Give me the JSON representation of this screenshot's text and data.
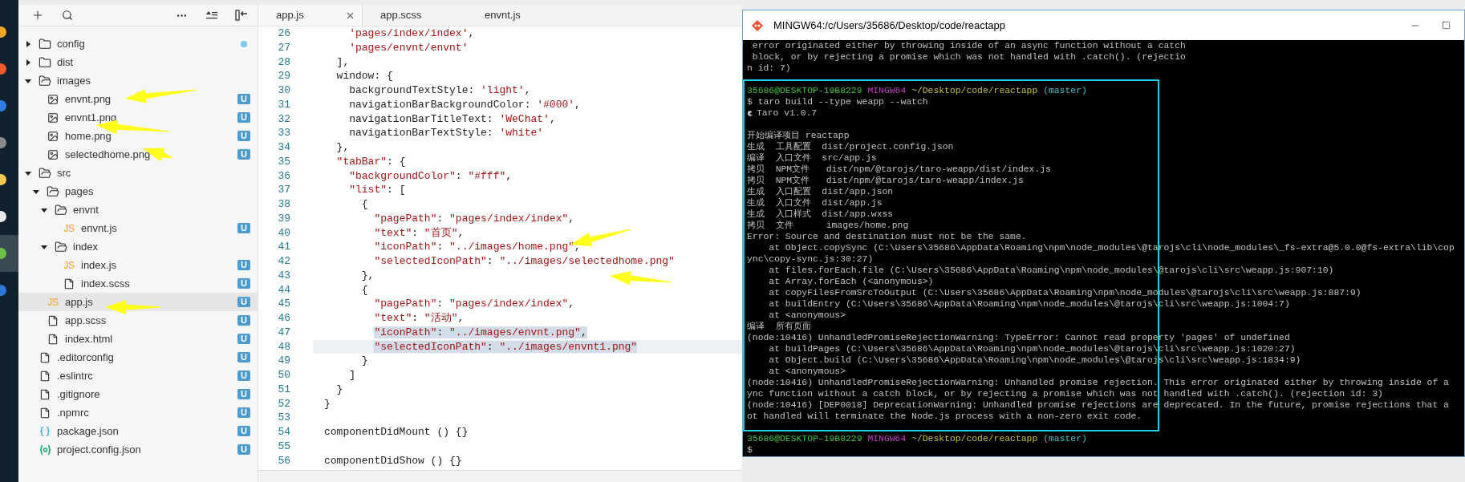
{
  "activity_bar": [
    {
      "selected": false
    },
    {
      "selected": false
    },
    {
      "selected": false
    },
    {
      "selected": false
    },
    {
      "selected": false
    },
    {
      "selected": false
    },
    {
      "selected": true
    },
    {
      "selected": false
    }
  ],
  "sidebar": {
    "tree": [
      {
        "name": "config",
        "kind": "folder",
        "expanded": false,
        "selected": false,
        "modified": true
      },
      {
        "name": "dist",
        "kind": "folder",
        "expanded": false,
        "selected": false
      },
      {
        "name": "images",
        "kind": "folder",
        "expanded": true,
        "selected": false,
        "children": [
          {
            "name": "envnt.png",
            "kind": "image",
            "selected": false,
            "badge": "U"
          },
          {
            "name": "envnt1.png",
            "kind": "image",
            "selected": false,
            "badge": "U"
          },
          {
            "name": "home.png",
            "kind": "image",
            "selected": false,
            "badge": "U"
          },
          {
            "name": "selectedhome.png",
            "kind": "image",
            "selected": false,
            "badge": "U"
          }
        ]
      },
      {
        "name": "src",
        "kind": "folder",
        "expanded": true,
        "selected": false,
        "children": [
          {
            "name": "pages",
            "kind": "folder",
            "expanded": true,
            "selected": false,
            "children": [
              {
                "name": "envnt",
                "kind": "folder",
                "expanded": true,
                "selected": false,
                "children": [
                  {
                    "name": "envnt.js",
                    "kind": "js",
                    "type_label": "JS",
                    "selected": false,
                    "badge": "U"
                  }
                ]
              },
              {
                "name": "index",
                "kind": "folder",
                "expanded": true,
                "selected": false,
                "children": [
                  {
                    "name": "index.js",
                    "kind": "js",
                    "type_label": "JS",
                    "selected": false,
                    "badge": "U"
                  },
                  {
                    "name": "index.scss",
                    "kind": "file",
                    "selected": false,
                    "badge": "U"
                  }
                ]
              }
            ]
          },
          {
            "name": "app.js",
            "kind": "js",
            "type_label": "JS",
            "selected": true,
            "badge": "U"
          },
          {
            "name": "app.scss",
            "kind": "file",
            "selected": false,
            "badge": "U"
          },
          {
            "name": "index.html",
            "kind": "file",
            "selected": false,
            "badge": "U"
          }
        ]
      },
      {
        "name": ".editorconfig",
        "kind": "file",
        "selected": false,
        "badge": "U"
      },
      {
        "name": ".eslintrc",
        "kind": "file",
        "selected": false,
        "badge": "U"
      },
      {
        "name": ".gitignore",
        "kind": "file",
        "selected": false,
        "badge": "U"
      },
      {
        "name": ".npmrc",
        "kind": "file",
        "selected": false,
        "badge": "U"
      },
      {
        "name": "package.json",
        "kind": "json",
        "selected": false,
        "badge": "U"
      },
      {
        "name": "project.config.json",
        "kind": "config",
        "selected": false,
        "badge": "U"
      }
    ]
  },
  "editor": {
    "tabs": [
      {
        "label": "app.js",
        "selected": true
      },
      {
        "label": "app.scss",
        "selected": false
      },
      {
        "label": "envnt.js",
        "selected": false
      }
    ],
    "lines": [
      {
        "number": "26",
        "selected": false,
        "current": false,
        "segments": [
          {
            "text": "    'pages/index/index'",
            "kind": "string"
          },
          {
            "text": ",",
            "kind": "plain"
          }
        ]
      },
      {
        "number": "27",
        "selected": false,
        "current": false,
        "segments": [
          {
            "text": "    'pages/envnt/envnt'",
            "kind": "string"
          }
        ]
      },
      {
        "number": "28",
        "selected": false,
        "current": false,
        "segments": [
          {
            "text": "  ],",
            "kind": "plain"
          }
        ]
      },
      {
        "number": "29",
        "selected": false,
        "current": false,
        "segments": [
          {
            "text": "  window: {",
            "kind": "plain"
          }
        ]
      },
      {
        "number": "30",
        "selected": false,
        "current": false,
        "segments": [
          {
            "text": "    backgroundTextStyle: ",
            "kind": "plain"
          },
          {
            "text": "'light'",
            "kind": "string"
          },
          {
            "text": ",",
            "kind": "plain"
          }
        ]
      },
      {
        "number": "31",
        "selected": false,
        "current": false,
        "segments": [
          {
            "text": "    navigationBarBackgroundColor: ",
            "kind": "plain"
          },
          {
            "text": "'#000'",
            "kind": "string"
          },
          {
            "text": ",",
            "kind": "plain"
          }
        ]
      },
      {
        "number": "32",
        "selected": false,
        "current": false,
        "segments": [
          {
            "text": "    navigationBarTitleText: ",
            "kind": "plain"
          },
          {
            "text": "'WeChat'",
            "kind": "string"
          },
          {
            "text": ",",
            "kind": "plain"
          }
        ]
      },
      {
        "number": "33",
        "selected": false,
        "current": false,
        "segments": [
          {
            "text": "    navigationBarTextStyle: ",
            "kind": "plain"
          },
          {
            "text": "'white'",
            "kind": "string"
          }
        ]
      },
      {
        "number": "34",
        "selected": false,
        "current": false,
        "segments": [
          {
            "text": "  },",
            "kind": "plain"
          }
        ]
      },
      {
        "number": "35",
        "selected": false,
        "current": false,
        "segments": [
          {
            "text": "  \"tabBar\"",
            "kind": "string"
          },
          {
            "text": ": {",
            "kind": "plain"
          }
        ]
      },
      {
        "number": "36",
        "selected": false,
        "current": false,
        "segments": [
          {
            "text": "    \"backgroundColor\"",
            "kind": "string"
          },
          {
            "text": ": ",
            "kind": "plain"
          },
          {
            "text": "\"#fff\"",
            "kind": "string"
          },
          {
            "text": ",",
            "kind": "plain"
          }
        ]
      },
      {
        "number": "37",
        "selected": false,
        "current": false,
        "segments": [
          {
            "text": "    \"list\"",
            "kind": "string"
          },
          {
            "text": ": [",
            "kind": "plain"
          }
        ]
      },
      {
        "number": "38",
        "selected": false,
        "current": false,
        "segments": [
          {
            "text": "      {",
            "kind": "plain"
          }
        ]
      },
      {
        "number": "39",
        "selected": false,
        "current": false,
        "segments": [
          {
            "text": "        \"pagePath\"",
            "kind": "string"
          },
          {
            "text": ": ",
            "kind": "plain"
          },
          {
            "text": "\"pages/index/index\"",
            "kind": "string"
          },
          {
            "text": ",",
            "kind": "plain"
          }
        ]
      },
      {
        "number": "40",
        "selected": false,
        "current": false,
        "segments": [
          {
            "text": "        \"text\"",
            "kind": "string"
          },
          {
            "text": ": ",
            "kind": "plain"
          },
          {
            "text": "\"首页\"",
            "kind": "string"
          },
          {
            "text": ",",
            "kind": "plain"
          }
        ]
      },
      {
        "number": "41",
        "selected": false,
        "current": false,
        "segments": [
          {
            "text": "        \"iconPath\"",
            "kind": "string"
          },
          {
            "text": ": ",
            "kind": "plain"
          },
          {
            "text": "\"../images/home.png\"",
            "kind": "string"
          },
          {
            "text": ",",
            "kind": "plain"
          }
        ]
      },
      {
        "number": "42",
        "selected": false,
        "current": false,
        "segments": [
          {
            "text": "        \"selectedIconPath\"",
            "kind": "string"
          },
          {
            "text": ": ",
            "kind": "plain"
          },
          {
            "text": "\"../images/selectedhome.png\"",
            "kind": "string"
          }
        ]
      },
      {
        "number": "43",
        "selected": false,
        "current": false,
        "segments": [
          {
            "text": "      },",
            "kind": "plain"
          }
        ]
      },
      {
        "number": "44",
        "selected": false,
        "current": false,
        "segments": [
          {
            "text": "      {",
            "kind": "plain"
          }
        ]
      },
      {
        "number": "45",
        "selected": false,
        "current": false,
        "segments": [
          {
            "text": "        \"pagePath\"",
            "kind": "string"
          },
          {
            "text": ": ",
            "kind": "plain"
          },
          {
            "text": "\"pages/index/index\"",
            "kind": "string"
          },
          {
            "text": ",",
            "kind": "plain"
          }
        ]
      },
      {
        "number": "46",
        "selected": false,
        "current": false,
        "segments": [
          {
            "text": "        \"text\"",
            "kind": "string"
          },
          {
            "text": ": ",
            "kind": "plain"
          },
          {
            "text": "\"活动\"",
            "kind": "string"
          },
          {
            "text": ",",
            "kind": "plain"
          }
        ]
      },
      {
        "number": "47",
        "selected": true,
        "current": false,
        "segments": [
          {
            "text": "        \"iconPath\"",
            "kind": "string"
          },
          {
            "text": ": ",
            "kind": "plain"
          },
          {
            "text": "\"../images/envnt.png\"",
            "kind": "string"
          },
          {
            "text": ",",
            "kind": "plain"
          }
        ]
      },
      {
        "number": "48",
        "selected": true,
        "current": true,
        "segments": [
          {
            "text": "        \"selectedIconPath\"",
            "kind": "string"
          },
          {
            "text": ": ",
            "kind": "plain"
          },
          {
            "text": "\"../images/envnt1.png\"",
            "kind": "string"
          }
        ]
      },
      {
        "number": "49",
        "selected": false,
        "current": false,
        "segments": [
          {
            "text": "      }",
            "kind": "plain"
          }
        ]
      },
      {
        "number": "50",
        "selected": false,
        "current": false,
        "segments": [
          {
            "text": "    ]",
            "kind": "plain"
          }
        ]
      },
      {
        "number": "51",
        "selected": false,
        "current": false,
        "segments": [
          {
            "text": "  }",
            "kind": "plain"
          }
        ]
      },
      {
        "number": "52",
        "selected": false,
        "current": false,
        "segments": [
          {
            "text": "}",
            "kind": "plain"
          }
        ]
      },
      {
        "number": "53"
      },
      {
        "number": "54",
        "selected": false,
        "current": false,
        "segments": [
          {
            "text": "componentDidMount () {}",
            "kind": "plain"
          }
        ]
      },
      {
        "number": "55"
      },
      {
        "number": "56",
        "selected": false,
        "current": false,
        "segments": [
          {
            "text": "componentDidShow () {}",
            "kind": "plain"
          }
        ]
      }
    ]
  },
  "terminal": {
    "title": "MINGW64:/c/Users/35686/Desktop/code/reactapp",
    "lines": [
      {
        "kind": "text",
        "segments": [
          {
            "text": " error originated either by throwing inside of an async function without a catch",
            "kind": "text"
          }
        ]
      },
      {
        "kind": "text",
        "segments": [
          {
            "text": " block, or by rejecting a promise which was not handled with .catch(). (rejectio",
            "kind": "text"
          }
        ]
      },
      {
        "kind": "text",
        "segments": [
          {
            "text": "n id: 7)",
            "kind": "text"
          }
        ]
      },
      {
        "kind": "blank"
      },
      {
        "kind": "text",
        "segments": [
          {
            "text": "35686@DESKTOP-19B8229",
            "kind": "user"
          },
          {
            "text": " MINGW64",
            "kind": "host"
          },
          {
            "text": " ~/Desktop/code/reactapp",
            "kind": "path"
          },
          {
            "text": " (master)",
            "kind": "branch"
          }
        ]
      },
      {
        "kind": "text",
        "segments": [
          {
            "text": "$ taro build --type weapp --watch",
            "kind": "text"
          }
        ]
      },
      {
        "kind": "logo",
        "segments": [
          {
            "text": "Taro v1.0.7",
            "kind": "text"
          }
        ]
      },
      {
        "kind": "blank"
      },
      {
        "kind": "text",
        "segments": [
          {
            "text": "开始编译项目 reactapp",
            "kind": "text"
          }
        ]
      },
      {
        "kind": "text",
        "segments": [
          {
            "text": "生成  工具配置  dist/project.config.json",
            "kind": "text"
          }
        ]
      },
      {
        "kind": "text",
        "segments": [
          {
            "text": "编译  入口文件  src/app.js",
            "kind": "text"
          }
        ]
      },
      {
        "kind": "text",
        "segments": [
          {
            "text": "拷贝  NPM文件   dist/npm/@tarojs/taro-weapp/dist/index.js",
            "kind": "text"
          }
        ]
      },
      {
        "kind": "text",
        "segments": [
          {
            "text": "拷贝  NPM文件   dist/npm/@tarojs/taro-weapp/index.js",
            "kind": "text"
          }
        ]
      },
      {
        "kind": "text",
        "segments": [
          {
            "text": "生成  入口配置  dist/app.json",
            "kind": "text"
          }
        ]
      },
      {
        "kind": "text",
        "segments": [
          {
            "text": "生成  入口文件  dist/app.js",
            "kind": "text"
          }
        ]
      },
      {
        "kind": "text",
        "segments": [
          {
            "text": "生成  入口样式  dist/app.wxss",
            "kind": "text"
          }
        ]
      },
      {
        "kind": "text",
        "segments": [
          {
            "text": "拷贝  文件      images/home.png",
            "kind": "text"
          }
        ]
      },
      {
        "kind": "text",
        "segments": [
          {
            "text": "Error: Source and destination must not be the same.",
            "kind": "text"
          }
        ]
      },
      {
        "kind": "text",
        "segments": [
          {
            "text": "    at Object.copySync (C:\\Users\\35686\\AppData\\Roaming\\npm\\node_modules\\@tarojs\\cli\\node_modules\\_fs-extra@5.0.0@fs-extra\\lib\\cop",
            "kind": "text"
          }
        ]
      },
      {
        "kind": "text",
        "segments": [
          {
            "text": "ync\\copy-sync.js:30:27)",
            "kind": "text"
          }
        ]
      },
      {
        "kind": "text",
        "segments": [
          {
            "text": "    at files.forEach.file (C:\\Users\\35686\\AppData\\Roaming\\npm\\node_modules\\@tarojs\\cli\\src\\weapp.js:907:10)",
            "kind": "text"
          }
        ]
      },
      {
        "kind": "text",
        "segments": [
          {
            "text": "    at Array.forEach (<anonymous>)",
            "kind": "text"
          }
        ]
      },
      {
        "kind": "text",
        "segments": [
          {
            "text": "    at copyFilesFromSrcToOutput (C:\\Users\\35686\\AppData\\Roaming\\npm\\node_modules\\@tarojs\\cli\\src\\weapp.js:887:9)",
            "kind": "text"
          }
        ]
      },
      {
        "kind": "text",
        "segments": [
          {
            "text": "    at buildEntry (C:\\Users\\35686\\AppData\\Roaming\\npm\\node_modules\\@tarojs\\cli\\src\\weapp.js:1004:7)",
            "kind": "text"
          }
        ]
      },
      {
        "kind": "text",
        "segments": [
          {
            "text": "    at <anonymous>",
            "kind": "text"
          }
        ]
      },
      {
        "kind": "text",
        "segments": [
          {
            "text": "编译  所有页面",
            "kind": "text"
          }
        ]
      },
      {
        "kind": "text",
        "segments": [
          {
            "text": "(node:10416) UnhandledPromiseRejectionWarning: TypeError: Cannot read property 'pages' of undefined",
            "kind": "text"
          }
        ]
      },
      {
        "kind": "text",
        "segments": [
          {
            "text": "    at buildPages (C:\\Users\\35686\\AppData\\Roaming\\npm\\node_modules\\@tarojs\\cli\\src\\weapp.js:1020:27)",
            "kind": "text"
          }
        ]
      },
      {
        "kind": "text",
        "segments": [
          {
            "text": "    at Object.build (C:\\Users\\35686\\AppData\\Roaming\\npm\\node_modules\\@tarojs\\cli\\src\\weapp.js:1834:9)",
            "kind": "text"
          }
        ]
      },
      {
        "kind": "text",
        "segments": [
          {
            "text": "    at <anonymous>",
            "kind": "text"
          }
        ]
      },
      {
        "kind": "text",
        "segments": [
          {
            "text": "(node:10416) UnhandledPromiseRejectionWarning: Unhandled promise rejection. This error originated either by throwing inside of a",
            "kind": "text"
          }
        ]
      },
      {
        "kind": "text",
        "segments": [
          {
            "text": "ync function without a catch block, or by rejecting a promise which was not handled with .catch(). (rejection id: 3)",
            "kind": "text"
          }
        ]
      },
      {
        "kind": "text",
        "segments": [
          {
            "text": "(node:10416) [DEP0018] DeprecationWarning: Unhandled promise rejections are deprecated. In the future, promise rejections that a",
            "kind": "text"
          }
        ]
      },
      {
        "kind": "text",
        "segments": [
          {
            "text": "ot handled will terminate the Node.js process with a non-zero exit code.",
            "kind": "text"
          }
        ]
      },
      {
        "kind": "blank"
      },
      {
        "kind": "text",
        "segments": [
          {
            "text": "35686@DESKTOP-19B8229",
            "kind": "user"
          },
          {
            "text": " MINGW64",
            "kind": "host"
          },
          {
            "text": " ~/Desktop/code/reactapp",
            "kind": "path"
          },
          {
            "text": " (master)",
            "kind": "branch"
          }
        ]
      },
      {
        "kind": "text",
        "segments": [
          {
            "text": "$",
            "kind": "text"
          }
        ]
      }
    ]
  }
}
